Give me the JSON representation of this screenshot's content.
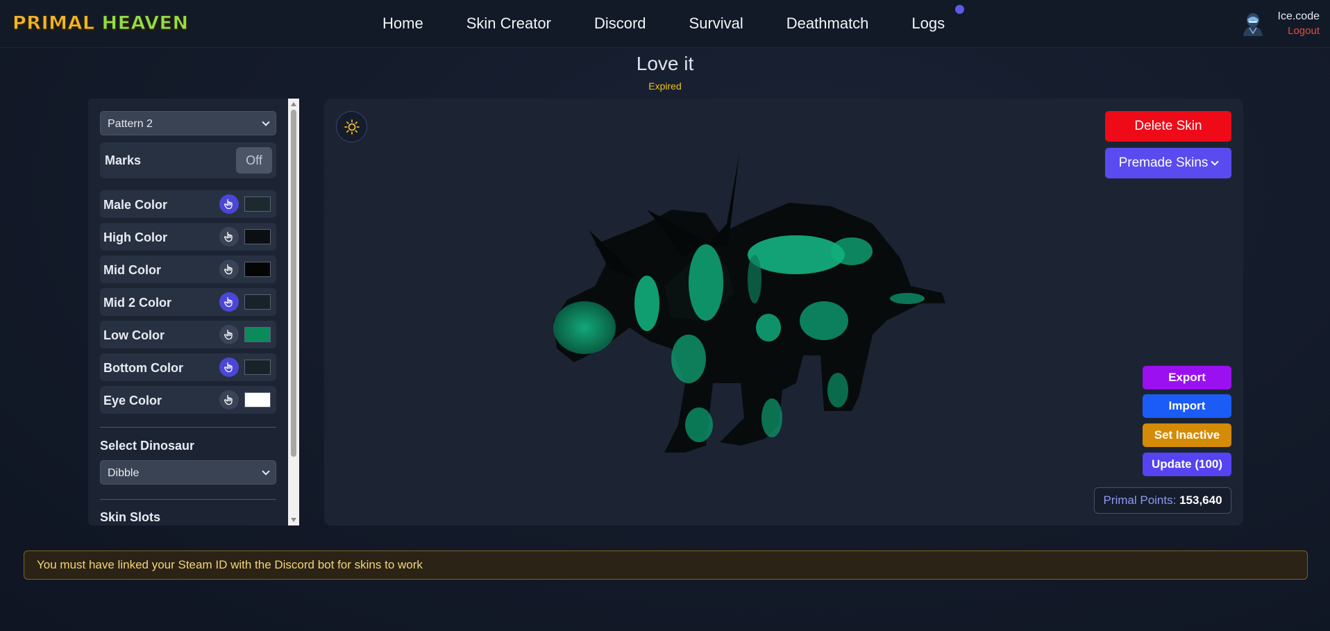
{
  "brand": {
    "word1": "PRIMAL",
    "word2": "HEAVEN"
  },
  "nav": {
    "items": [
      {
        "label": "Home"
      },
      {
        "label": "Skin Creator"
      },
      {
        "label": "Discord"
      },
      {
        "label": "Survival"
      },
      {
        "label": "Deathmatch"
      },
      {
        "label": "Logs"
      }
    ]
  },
  "user": {
    "name": "Ice.code",
    "logout_label": "Logout"
  },
  "skin": {
    "title": "Love it",
    "status": "Expired"
  },
  "sidebar": {
    "pattern_select": "Pattern 2",
    "marks": {
      "label": "Marks",
      "toggle": "Off"
    },
    "colors": [
      {
        "label": "Male Color",
        "swatch": "#1c2a30",
        "picker_active": true
      },
      {
        "label": "High Color",
        "swatch": "#0b0f12",
        "picker_active": false
      },
      {
        "label": "Mid Color",
        "swatch": "#040606",
        "picker_active": false
      },
      {
        "label": "Mid 2 Color",
        "swatch": "#182228",
        "picker_active": true
      },
      {
        "label": "Low Color",
        "swatch": "#0b8a5c",
        "picker_active": false
      },
      {
        "label": "Bottom Color",
        "swatch": "#182228",
        "picker_active": true
      },
      {
        "label": "Eye Color",
        "swatch": "#ffffff",
        "picker_active": false
      }
    ],
    "select_dino_label": "Select Dinosaur",
    "dino_select": "Dibble",
    "skin_slots_label": "Skin Slots"
  },
  "viewer": {
    "delete_label": "Delete Skin",
    "premade_label": "Premade Skins",
    "export_label": "Export",
    "import_label": "Import",
    "inactive_label": "Set Inactive",
    "update_label": "Update (100)",
    "points_label": "Primal Points:",
    "points_value": "153,640"
  },
  "notice": "You must have linked your Steam ID with the Discord bot for skins to work",
  "colors": {
    "accent": "#5a4bf0",
    "danger": "#ee0a17",
    "export": "#9b10f0",
    "import": "#1a5cf5",
    "inactive": "#d48b06",
    "warning_text": "#f0c419"
  }
}
